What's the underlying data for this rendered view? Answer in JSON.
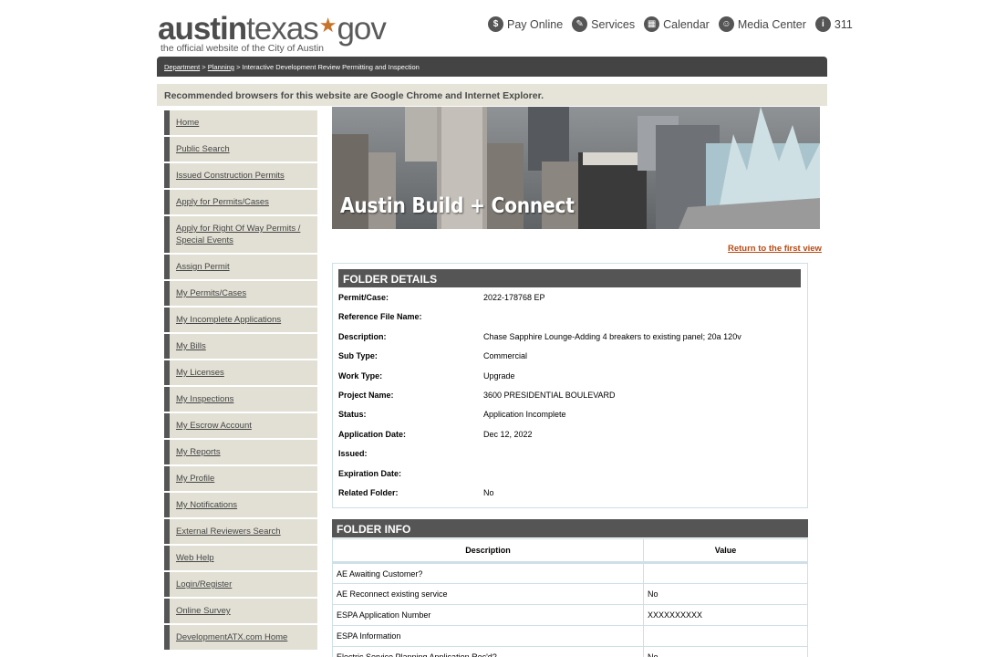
{
  "header": {
    "logo_bold": "austin",
    "logo_rest": "texas",
    "logo_gov": "gov",
    "logo_tagline": "the official website of the City of Austin",
    "nav": [
      {
        "label": "Pay Online",
        "icon": "pay-online-icon"
      },
      {
        "label": "Services",
        "icon": "services-icon"
      },
      {
        "label": "Calendar",
        "icon": "calendar-icon"
      },
      {
        "label": "Media Center",
        "icon": "media-center-icon"
      },
      {
        "label": "311",
        "icon": "info-icon"
      }
    ]
  },
  "breadcrumb": {
    "items": [
      "Department",
      "Planning"
    ],
    "current": "Interactive Development Review Permitting and Inspection",
    "sep": ">"
  },
  "notice": "Recommended browsers for this website are Google Chrome and Internet Explorer.",
  "sidebar": {
    "items": [
      "Home",
      "Public Search",
      "Issued Construction Permits",
      "Apply for Permits/Cases",
      "Apply for Right Of Way Permits / Special Events",
      "Assign Permit",
      "My Permits/Cases",
      "My Incomplete Applications",
      "My Bills",
      "My Licenses",
      "My Inspections",
      "My Escrow Account",
      "My Reports",
      "My Profile",
      "My Notifications",
      "External Reviewers Search",
      "Web Help",
      "Login/Register",
      "Online Survey",
      "DevelopmentATX.com Home"
    ]
  },
  "hero": {
    "title": "Austin Build + Connect"
  },
  "return_link": "Return to the first view",
  "folder_details": {
    "title": "FOLDER DETAILS",
    "rows": [
      {
        "label": "Permit/Case:",
        "value": "2022-178768 EP"
      },
      {
        "label": "Reference File Name:",
        "value": ""
      },
      {
        "label": "Description:",
        "value": "Chase Sapphire Lounge-Adding 4 breakers to existing panel; 20a 120v"
      },
      {
        "label": "Sub Type:",
        "value": "Commercial"
      },
      {
        "label": "Work Type:",
        "value": "Upgrade"
      },
      {
        "label": "Project Name:",
        "value": "3600 PRESIDENTIAL BOULEVARD"
      },
      {
        "label": "Status:",
        "value": "Application Incomplete"
      },
      {
        "label": "Application Date:",
        "value": "Dec 12, 2022"
      },
      {
        "label": "Issued:",
        "value": ""
      },
      {
        "label": "Expiration Date:",
        "value": ""
      },
      {
        "label": "Related Folder:",
        "value": "No"
      }
    ]
  },
  "folder_info": {
    "title": "FOLDER INFO",
    "columns": [
      "Description",
      "Value"
    ],
    "rows": [
      {
        "description": "AE Awaiting Customer?",
        "value": ""
      },
      {
        "description": "AE Reconnect existing service",
        "value": "No"
      },
      {
        "description": "ESPA Application Number",
        "value": "XXXXXXXXXX"
      },
      {
        "description": "ESPA Information",
        "value": ""
      },
      {
        "description": "Electric Service Planning Application Rec'd?",
        "value": "No"
      }
    ]
  }
}
